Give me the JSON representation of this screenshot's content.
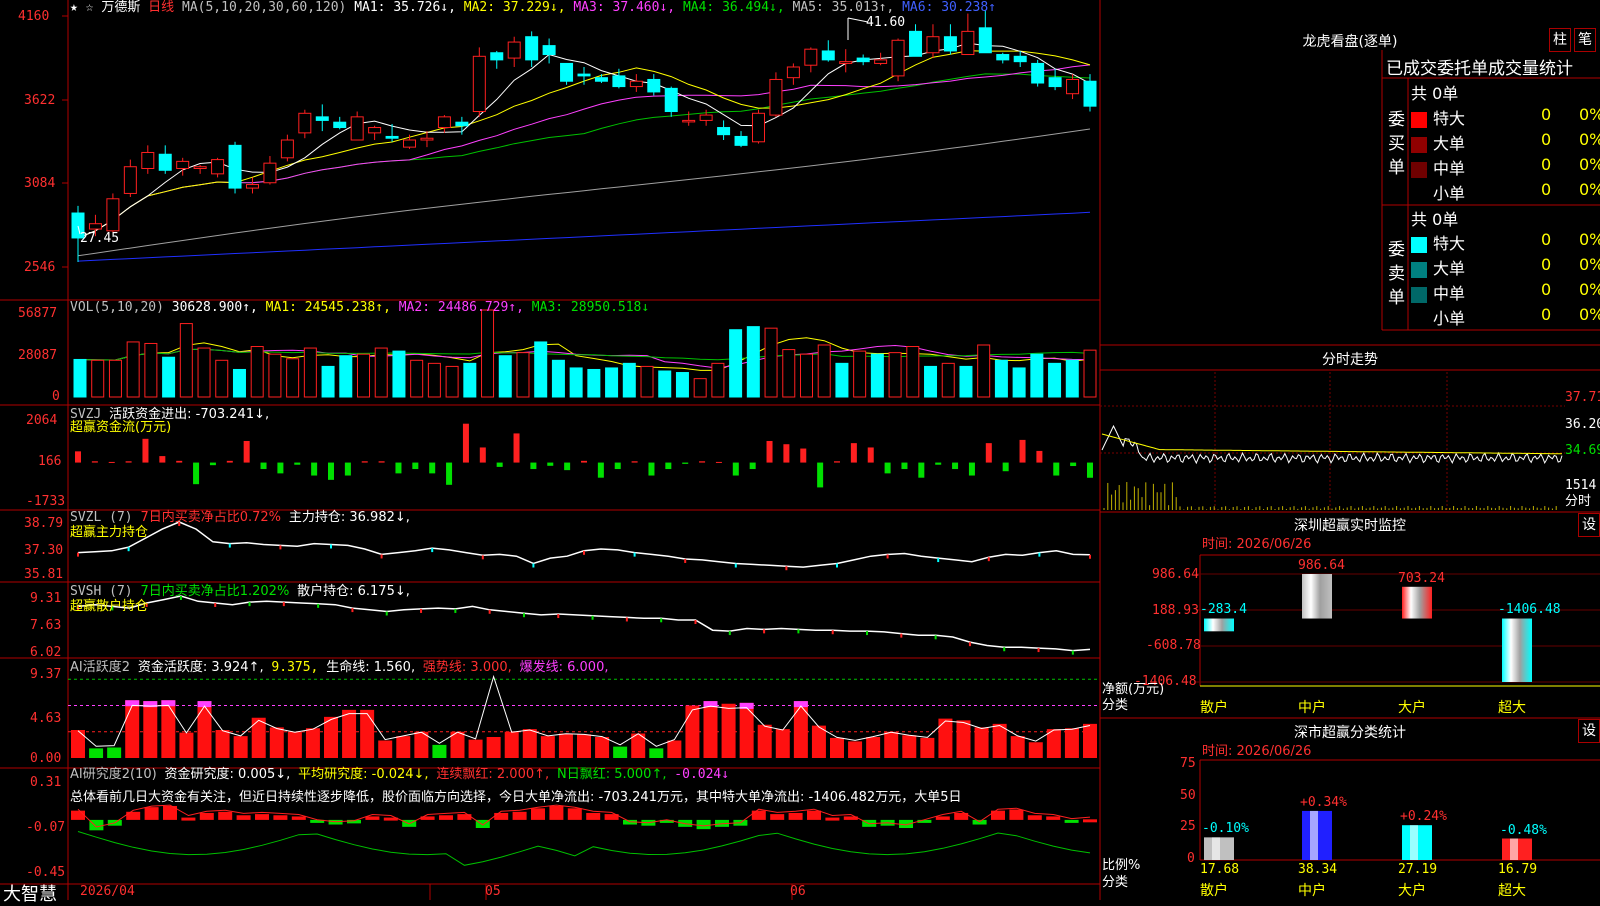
{
  "header": {
    "stock_name": "万德斯",
    "period": "日线",
    "ma_spec": "MA(5,10,20,30,60,120)",
    "ma1": "MA1: 35.726↓,",
    "ma2": "MA2: 37.229↓,",
    "ma3": "MA3: 37.460↓,",
    "ma4": "MA4: 36.494↓,",
    "ma5": "MA5: 35.013↑,",
    "ma6": "MA6: 30.238↑",
    "high_mark": "41.60",
    "low_mark": "27.45"
  },
  "price_axis": [
    "4160",
    "3622",
    "3084",
    "2546"
  ],
  "vol": {
    "label": "VOL(5,10,20)",
    "value": "30628.900↑,",
    "ma1": "MA1: 24545.238↑,",
    "ma2": "MA2: 24486.729↑,",
    "ma3": "MA3: 28950.518↓",
    "axis": [
      "56877",
      "28087",
      "0"
    ]
  },
  "svzj": {
    "label": "SVZJ",
    "title": "活跃资金进出: -703.241↓,",
    "subtitle": "超赢资金流(万元)",
    "axis": [
      "2064",
      "166",
      "-1733"
    ]
  },
  "svzl": {
    "label": "SVZL (7)",
    "ratio": "7日内买卖净占比0.72%",
    "holding": "主力持仓: 36.982↓,",
    "subtitle": "超赢主力持仓",
    "axis": [
      "38.79",
      "37.30",
      "35.81"
    ]
  },
  "svsh": {
    "label": "SVSH (7)",
    "ratio": "7日内买卖净占比1.202%",
    "holding": "散户持仓: 6.175↓,",
    "subtitle": "超赢散户持仓",
    "axis": [
      "9.31",
      "7.63",
      "6.02"
    ]
  },
  "ai_active": {
    "label": "AI活跃度2",
    "v1": "资金活跃度: 3.924↑,",
    "v2": "9.375,",
    "v3": "生命线: 1.560,",
    "v4": "强势线: 3.000,",
    "v5": "爆发线: 6.000,",
    "axis": [
      "9.37",
      "4.63",
      "0.00"
    ]
  },
  "ai_research": {
    "label": "AI研究度2(10)",
    "v1": "资金研究度: 0.005↓,",
    "v2": "平均研究度: -0.024↓,",
    "v3": "连续飘红: 2.000↑,",
    "v4": "N日飘红: 5.000↑,",
    "v5": "-0.024↓",
    "comment": "总体看前几日大资金有关注，但近日持续性逐步降低，股价面临方向选择，今日大单净流出: -703.241万元，其中特大单净流出: -1406.482万元，大单5日",
    "axis": [
      "0.31",
      "-0.07",
      "-0.45"
    ]
  },
  "footer": {
    "brand": "大智慧",
    "dates": [
      "2026/04",
      "05",
      "06"
    ]
  },
  "right": {
    "lhb_title": "龙虎看盘(逐单)",
    "btn_zhu": "柱",
    "btn_bi": "笔",
    "order_header": "已成交委托单成交量统计",
    "buy_label": "委买单",
    "sell_label": "委卖单",
    "buy_total": "共 0单",
    "sell_total": "共 0单",
    "buy_rows": [
      {
        "name": "特大",
        "count": "0",
        "pct": "0%",
        "color": "#ff0000"
      },
      {
        "name": "大单",
        "count": "0",
        "pct": "0%",
        "color": "#900000"
      },
      {
        "name": "中单",
        "count": "0",
        "pct": "0%",
        "color": "#700000"
      },
      {
        "name": "小单",
        "count": "0",
        "pct": "0%",
        "color": "#000000"
      }
    ],
    "sell_rows": [
      {
        "name": "特大",
        "count": "0",
        "pct": "0%",
        "color": "#00ffff"
      },
      {
        "name": "大单",
        "count": "0",
        "pct": "0%",
        "color": "#008080"
      },
      {
        "name": "中单",
        "count": "0",
        "pct": "0%",
        "color": "#006868"
      },
      {
        "name": "小单",
        "count": "0",
        "pct": "0%",
        "color": "#000000"
      }
    ],
    "intraday_title": "分时走势",
    "intraday_axis": [
      "37.71",
      "36.20",
      "34.69",
      "1514",
      "分时"
    ],
    "sz_title": "深圳超赢实时监控",
    "sz_set": "设",
    "sz_time": "时间: 2026/06/26",
    "sz_axis": [
      "986.64",
      "188.93",
      "-608.78",
      "-1406.48"
    ],
    "sz_unit": "净额(万元)",
    "sz_cat_label": "分类",
    "sz_categories": [
      "散户",
      "中户",
      "大户",
      "超大"
    ],
    "sz_values": [
      "-283.4",
      "986.64",
      "703.24",
      "-1406.48"
    ],
    "ss_title": "深市超赢分类统计",
    "ss_set": "设",
    "ss_time": "时间: 2026/06/26",
    "ss_axis": [
      "75",
      "50",
      "25",
      "0"
    ],
    "ss_unit": "比例%",
    "ss_cat_label": "分类",
    "ss_categories": [
      "散户",
      "中户",
      "大户",
      "超大"
    ],
    "ss_pcts": [
      "17.68",
      "38.34",
      "27.19",
      "16.79"
    ],
    "ss_changes": [
      "-0.10%",
      "+0.34%",
      "+0.24%",
      "-0.48%"
    ]
  },
  "colors": {
    "up": "#ff2020",
    "down": "#00ffff",
    "frame": "#b00000",
    "ma1": "#ffffff",
    "ma2": "#ffff00",
    "ma3": "#ff40ff",
    "ma4": "#00c000",
    "ma5": "#a0a0a0",
    "ma6": "#2030ff"
  },
  "chart_data": [
    {
      "type": "bar",
      "name": "daily_candles",
      "note_ohlc_order": "open,high,low,close",
      "ohlc": [
        [
          30.2,
          30.6,
          27.45,
          28.8
        ],
        [
          29.3,
          30.1,
          28.9,
          29.6
        ],
        [
          29.2,
          31.3,
          29.1,
          31.0
        ],
        [
          31.3,
          33.2,
          31.1,
          32.8
        ],
        [
          32.7,
          34.0,
          32.4,
          33.6
        ],
        [
          33.5,
          34.0,
          32.4,
          32.6
        ],
        [
          32.7,
          33.3,
          32.3,
          33.1
        ],
        [
          32.7,
          32.9,
          32.4,
          32.8
        ],
        [
          32.4,
          33.3,
          32.2,
          33.2
        ],
        [
          34.0,
          34.2,
          31.3,
          31.6
        ],
        [
          31.6,
          32.2,
          31.3,
          31.8
        ],
        [
          31.9,
          33.4,
          31.8,
          33.0
        ],
        [
          33.3,
          34.6,
          33.1,
          34.3
        ],
        [
          34.7,
          36.0,
          34.4,
          35.8
        ],
        [
          35.6,
          36.3,
          34.8,
          35.4
        ],
        [
          35.3,
          35.6,
          34.9,
          35.0
        ],
        [
          34.3,
          35.9,
          34.3,
          35.6
        ],
        [
          34.7,
          35.1,
          34.3,
          35.0
        ],
        [
          34.5,
          35.2,
          34.2,
          34.4
        ],
        [
          33.9,
          34.6,
          33.8,
          34.3
        ],
        [
          34.3,
          34.8,
          33.9,
          34.4
        ],
        [
          35.0,
          35.7,
          34.7,
          35.6
        ],
        [
          35.3,
          35.6,
          34.6,
          35.1
        ],
        [
          35.9,
          39.5,
          35.6,
          39.0
        ],
        [
          39.2,
          39.3,
          38.3,
          38.8
        ],
        [
          38.9,
          40.1,
          38.4,
          39.8
        ],
        [
          40.1,
          40.4,
          38.4,
          38.8
        ],
        [
          39.6,
          40.0,
          38.6,
          39.1
        ],
        [
          38.6,
          38.6,
          37.4,
          37.6
        ],
        [
          38.0,
          38.4,
          37.4,
          37.9
        ],
        [
          37.8,
          38.0,
          37.5,
          37.6
        ],
        [
          37.9,
          38.3,
          37.2,
          37.3
        ],
        [
          37.3,
          38.0,
          37.0,
          37.6
        ],
        [
          37.7,
          38.0,
          36.8,
          37.0
        ],
        [
          37.2,
          37.3,
          35.6,
          35.9
        ],
        [
          35.4,
          35.9,
          35.1,
          35.4
        ],
        [
          35.4,
          36.0,
          35.1,
          35.7
        ],
        [
          35.0,
          35.4,
          34.3,
          34.6
        ],
        [
          34.5,
          34.8,
          33.9,
          34.0
        ],
        [
          34.2,
          36.0,
          34.1,
          35.8
        ],
        [
          35.7,
          38.1,
          35.6,
          37.7
        ],
        [
          37.8,
          38.6,
          37.4,
          38.4
        ],
        [
          38.5,
          39.5,
          38.1,
          39.4
        ],
        [
          39.3,
          39.9,
          38.7,
          38.8
        ],
        [
          38.6,
          39.4,
          38.1,
          38.7
        ],
        [
          38.9,
          39.1,
          38.5,
          38.7
        ],
        [
          38.6,
          39.2,
          38.5,
          38.8
        ],
        [
          37.9,
          40.0,
          37.6,
          39.9
        ],
        [
          40.4,
          40.8,
          39.1,
          39.0
        ],
        [
          39.2,
          40.8,
          38.9,
          40.1
        ],
        [
          40.1,
          40.8,
          39.1,
          39.3
        ],
        [
          39.1,
          41.4,
          39.1,
          40.4
        ],
        [
          40.6,
          41.6,
          39.2,
          39.2
        ],
        [
          39.1,
          39.2,
          38.6,
          38.8
        ],
        [
          39.0,
          39.3,
          38.4,
          38.7
        ],
        [
          38.6,
          38.8,
          37.3,
          37.5
        ],
        [
          37.8,
          38.3,
          37.1,
          37.3
        ],
        [
          36.9,
          38.0,
          36.6,
          37.7
        ],
        [
          37.6,
          38.0,
          35.9,
          36.2
        ]
      ]
    },
    {
      "type": "bar",
      "name": "volume",
      "axis_ticks": [
        "56877",
        "28087",
        "0"
      ],
      "values": [
        24545,
        24000,
        24000,
        36000,
        35000,
        26000,
        48000,
        32000,
        24000,
        18000,
        33000,
        28000,
        25000,
        32000,
        20000,
        27000,
        28000,
        32000,
        30000,
        24000,
        22000,
        20000,
        22000,
        56877,
        27000,
        29000,
        36000,
        24000,
        19000,
        18000,
        19000,
        22000,
        20000,
        17000,
        16000,
        12000,
        22000,
        44000,
        46000,
        45000,
        31000,
        28000,
        34000,
        22000,
        30000,
        28000,
        29000,
        33000,
        20000,
        22000,
        20000,
        34000,
        24000,
        19000,
        28000,
        22000,
        24000,
        30628
      ]
    },
    {
      "type": "bar",
      "name": "svzj_fund_flow",
      "unit": "万元",
      "axis_ticks": [
        "2064",
        "166",
        "-1733"
      ],
      "values": [
        520,
        60,
        30,
        60,
        1100,
        300,
        80,
        -1000,
        -120,
        80,
        1000,
        -300,
        -500,
        -100,
        -600,
        -800,
        -600,
        60,
        60,
        -500,
        -300,
        -500,
        -1030,
        1800,
        700,
        -200,
        1350,
        -300,
        -150,
        -350,
        80,
        -700,
        -300,
        60,
        -600,
        -300,
        -60,
        60,
        30,
        -600,
        -300,
        1000,
        850,
        650,
        -1150,
        60,
        900,
        700,
        -500,
        -300,
        -700,
        -100,
        -300,
        -600,
        900,
        -400,
        1050,
        540,
        -600,
        -160,
        -703
      ]
    },
    {
      "type": "line",
      "name": "svzl_main_holding",
      "axis_ticks": [
        "38.79",
        "37.30",
        "35.81"
      ],
      "values": [
        37.1,
        37.15,
        37.2,
        37.4,
        37.9,
        38.4,
        38.79,
        38.4,
        37.7,
        37.6,
        37.65,
        37.55,
        37.5,
        37.45,
        37.6,
        37.55,
        37.5,
        37.3,
        37.0,
        37.1,
        37.2,
        37.35,
        37.25,
        37.1,
        36.95,
        37.0,
        36.9,
        36.5,
        36.8,
        36.9,
        37.2,
        37.3,
        37.25,
        37.1,
        37.0,
        36.9,
        36.75,
        36.7,
        36.6,
        36.5,
        36.45,
        36.4,
        36.35,
        36.3,
        36.4,
        36.5,
        36.7,
        36.9,
        37.0,
        37.05,
        36.9,
        36.8,
        36.7,
        36.6,
        36.85,
        37.0,
        36.95,
        37.1,
        37.2,
        37.0,
        36.982
      ]
    },
    {
      "type": "line",
      "name": "svsh_retail_holding",
      "axis_ticks": [
        "9.31",
        "7.63",
        "6.02"
      ],
      "values": [
        8.7,
        8.8,
        8.7,
        8.6,
        8.9,
        9.1,
        9.31,
        9.0,
        8.9,
        8.8,
        8.95,
        9.0,
        8.95,
        8.9,
        8.85,
        8.8,
        8.6,
        8.5,
        8.4,
        8.5,
        8.55,
        8.6,
        8.55,
        8.7,
        8.5,
        8.4,
        8.3,
        8.2,
        8.25,
        8.2,
        8.15,
        8.1,
        8.05,
        8.0,
        8.0,
        7.9,
        7.9,
        7.3,
        7.25,
        7.4,
        7.35,
        7.4,
        7.35,
        7.3,
        7.3,
        7.25,
        7.25,
        7.2,
        7.1,
        7.0,
        7.0,
        6.9,
        6.6,
        6.4,
        6.3,
        6.3,
        6.25,
        6.2,
        6.1,
        6.175
      ]
    },
    {
      "type": "bar",
      "name": "ai_active",
      "axis_ticks": [
        "9.37",
        "4.63",
        "0.00"
      ],
      "values": [
        3.2,
        1.1,
        1.2,
        6.6,
        6.5,
        6.6,
        2.9,
        6.5,
        3.2,
        2.5,
        4.6,
        3.5,
        3.0,
        3.4,
        4.7,
        5.5,
        5.5,
        2.0,
        2.5,
        3.0,
        1.5,
        3.0,
        2.1,
        2.4,
        3.0,
        3.3,
        2.5,
        2.8,
        2.7,
        2.4,
        1.3,
        2.8,
        1.1,
        2.0,
        6.0,
        6.5,
        6.2,
        6.3,
        3.8,
        3.3,
        6.5,
        3.7,
        2.3,
        1.9,
        2.4,
        3.0,
        2.6,
        2.3,
        4.5,
        4.3,
        3.5,
        3.9,
        2.5,
        1.8,
        3.3,
        3.4,
        3.9
      ]
    },
    {
      "type": "bar",
      "name": "ai_research",
      "axis_ticks": [
        "0.31",
        "-0.07",
        "-0.45"
      ],
      "values": [
        0.08,
        -0.09,
        -0.05,
        0.07,
        0.11,
        0.12,
        0.02,
        0.06,
        0.07,
        0.04,
        0.05,
        0.04,
        0.03,
        -0.02,
        -0.04,
        -0.03,
        0.03,
        0.02,
        -0.06,
        0.03,
        0.04,
        0.05,
        -0.07,
        0.06,
        0.07,
        0.1,
        0.12,
        0.1,
        0.06,
        0.05,
        -0.04,
        -0.05,
        -0.02,
        -0.06,
        -0.08,
        -0.06,
        -0.05,
        0.08,
        0.05,
        0.06,
        0.08,
        0.02,
        0.03,
        -0.06,
        -0.05,
        -0.07,
        -0.02,
        0.03,
        0.06,
        -0.04,
        0.08,
        0.09,
        0.04,
        0.03,
        -0.01,
        0.005
      ]
    }
  ]
}
